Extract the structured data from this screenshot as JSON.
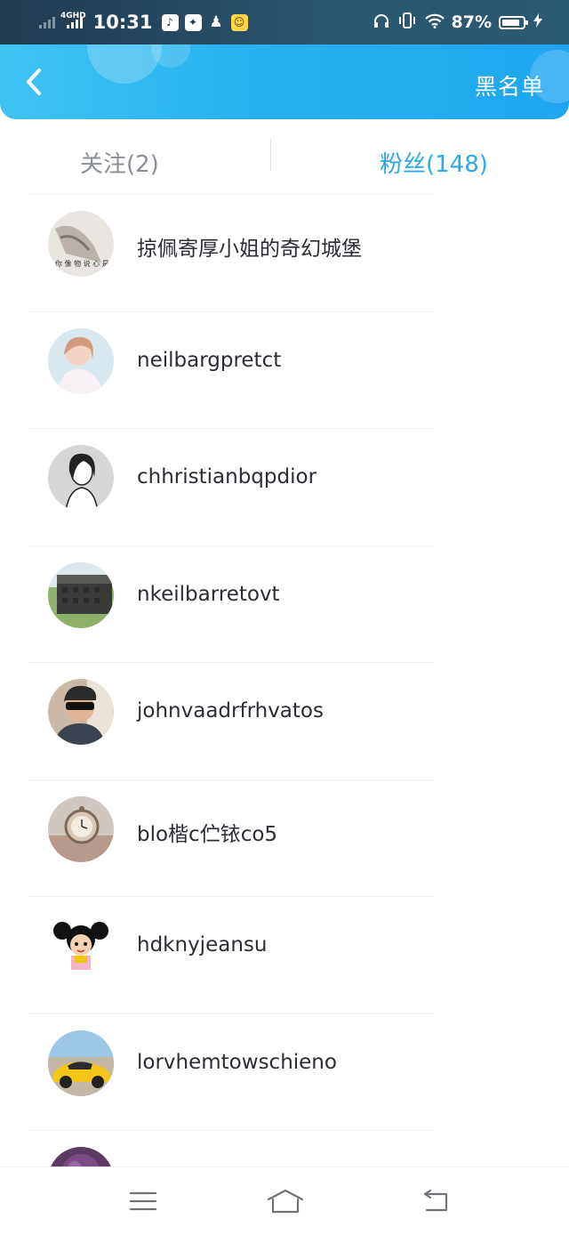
{
  "status_bar": {
    "network": "4GHD",
    "time": "10:31",
    "battery_percent": "87%",
    "battery_level": 0.87,
    "notification_icons": [
      "music-note-icon",
      "game-controller-icon",
      "qq-penguin-icon",
      "chat-app-icon"
    ],
    "system_icons": [
      "headphones-icon",
      "vibrate-icon",
      "wifi-icon",
      "battery-icon",
      "charging-bolt-icon"
    ]
  },
  "header": {
    "back_icon": "chevron-left-icon",
    "blacklist_label": "黑名单"
  },
  "tabs": [
    {
      "label": "关注(2)",
      "active": false
    },
    {
      "label": "粉丝(148)",
      "active": true
    }
  ],
  "colors": {
    "header_start": "#3fc3f2",
    "header_end": "#1fa6ef",
    "active_tab": "#2fa7e4",
    "inactive_tab": "#8a8f96"
  },
  "fans": [
    {
      "name": "掠佩寄厚小姐的奇幻城堡",
      "avatar_icon": "sketch-avatar"
    },
    {
      "name": "neilbargpretct",
      "avatar_icon": "girl-photo-avatar"
    },
    {
      "name": "chhristianbqpdior",
      "avatar_icon": "portrait-drawing-avatar"
    },
    {
      "name": "nkeilbarretovt",
      "avatar_icon": "castle-photo-avatar"
    },
    {
      "name": "johnvaadrfrhvatos",
      "avatar_icon": "man-sunglasses-avatar"
    },
    {
      "name": "blo楷c伫铱co5",
      "avatar_icon": "pocket-watch-avatar"
    },
    {
      "name": "hdknyjeansu",
      "avatar_icon": "cartoon-girl-avatar"
    },
    {
      "name": "lorvhemtowschieno",
      "avatar_icon": "yellow-car-avatar"
    },
    {
      "name": "",
      "avatar_icon": "purple-flower-avatar"
    }
  ],
  "nav_bar": {
    "icons": [
      "menu-icon",
      "home-icon",
      "back-icon"
    ]
  }
}
